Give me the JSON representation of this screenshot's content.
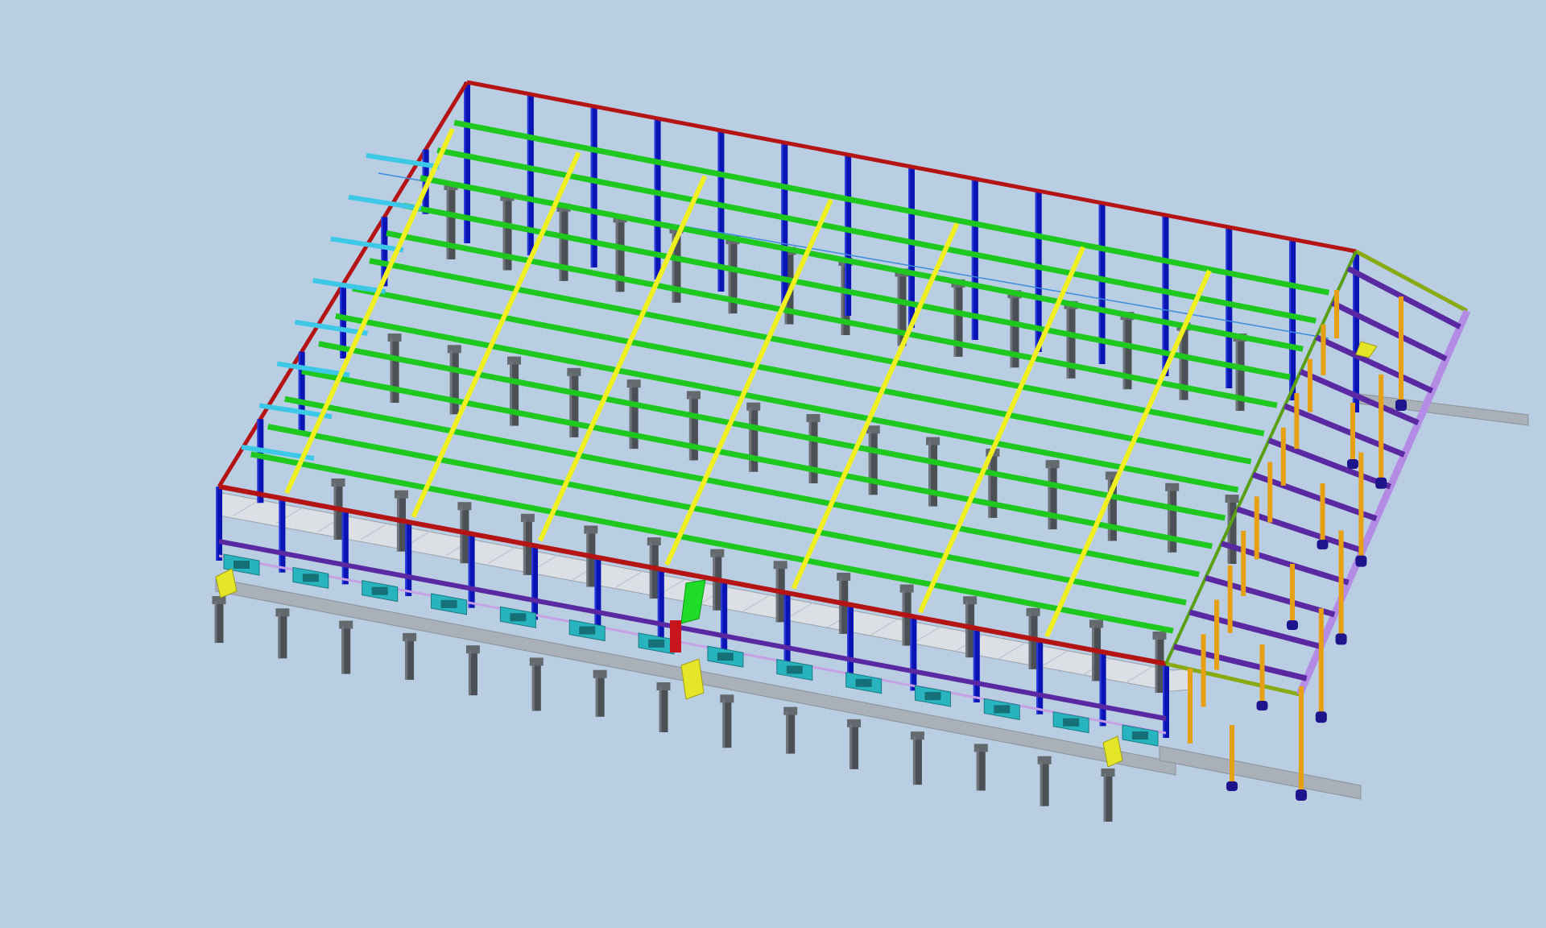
{
  "viewport": {
    "background": "#b9cde3"
  },
  "model": {
    "colors": {
      "column": "#0a14b4",
      "column_light": "#2a3cdc",
      "edge_beam": "#b41414",
      "roof_beam": "#1ec81e",
      "cross_beam": "#f0f020",
      "lower_beam": "#5a28a0",
      "canopy_beam": "#5a28a0",
      "canopy_edge": "#b48ce6",
      "post": "#e6a014",
      "pile": "#4b5055",
      "pile_head": "#64696e",
      "slab": "#cfd2d8",
      "plinth": "#aab0b8",
      "cyan_brace": "#3cc8e6",
      "teal_unit": "#28b4be",
      "stair_yellow": "#e6e628",
      "stair_green": "#1edc28",
      "anchor": "#1e148c",
      "rail": "#3c8cdc"
    }
  }
}
